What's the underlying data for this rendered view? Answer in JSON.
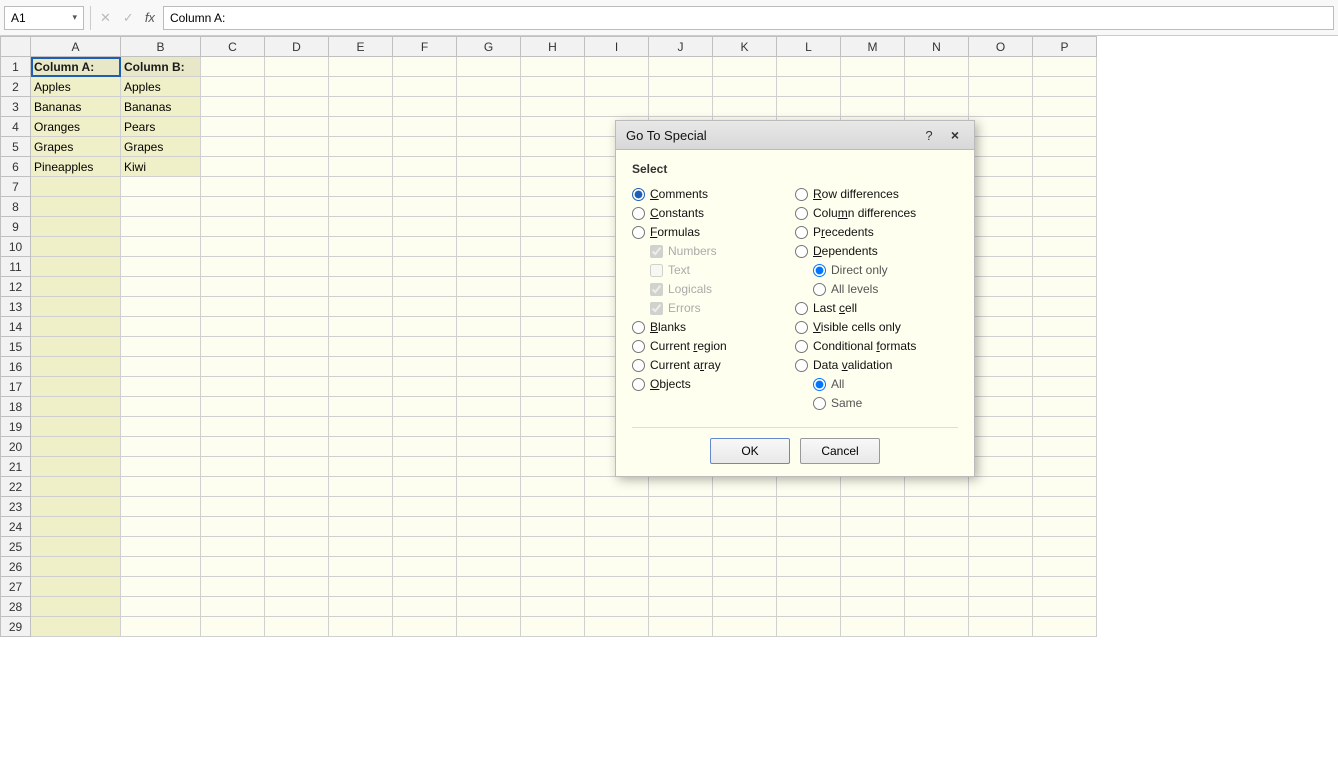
{
  "formula_bar": {
    "cell_ref": "A1",
    "formula_content": "Column A:",
    "undo_icon": "✕",
    "confirm_icon": "✓",
    "fx_label": "fx"
  },
  "spreadsheet": {
    "columns": [
      "A",
      "B",
      "C",
      "D",
      "E",
      "F",
      "G",
      "H",
      "I",
      "J",
      "K",
      "L",
      "M",
      "N",
      "O",
      "P"
    ],
    "rows": [
      {
        "row_num": 1,
        "col_a": "Column A:",
        "col_b": "Column B:",
        "is_header": true
      },
      {
        "row_num": 2,
        "col_a": "Apples",
        "col_b": "Apples"
      },
      {
        "row_num": 3,
        "col_a": "Bananas",
        "col_b": "Bananas"
      },
      {
        "row_num": 4,
        "col_a": "Oranges",
        "col_b": "Pears"
      },
      {
        "row_num": 5,
        "col_a": "Grapes",
        "col_b": "Grapes"
      },
      {
        "row_num": 6,
        "col_a": "Pineapples",
        "col_b": "Kiwi"
      },
      {
        "row_num": 7,
        "col_a": "",
        "col_b": ""
      },
      {
        "row_num": 8,
        "col_a": "",
        "col_b": ""
      },
      {
        "row_num": 9,
        "col_a": "",
        "col_b": ""
      },
      {
        "row_num": 10,
        "col_a": "",
        "col_b": ""
      },
      {
        "row_num": 11,
        "col_a": "",
        "col_b": ""
      },
      {
        "row_num": 12,
        "col_a": "",
        "col_b": ""
      },
      {
        "row_num": 13,
        "col_a": "",
        "col_b": ""
      },
      {
        "row_num": 14,
        "col_a": "",
        "col_b": ""
      },
      {
        "row_num": 15,
        "col_a": "",
        "col_b": ""
      },
      {
        "row_num": 16,
        "col_a": "",
        "col_b": ""
      },
      {
        "row_num": 17,
        "col_a": "",
        "col_b": ""
      },
      {
        "row_num": 18,
        "col_a": "",
        "col_b": ""
      },
      {
        "row_num": 19,
        "col_a": "",
        "col_b": ""
      },
      {
        "row_num": 20,
        "col_a": "",
        "col_b": ""
      },
      {
        "row_num": 21,
        "col_a": "",
        "col_b": ""
      },
      {
        "row_num": 22,
        "col_a": "",
        "col_b": ""
      },
      {
        "row_num": 23,
        "col_a": "",
        "col_b": ""
      },
      {
        "row_num": 24,
        "col_a": "",
        "col_b": ""
      },
      {
        "row_num": 25,
        "col_a": "",
        "col_b": ""
      },
      {
        "row_num": 26,
        "col_a": "",
        "col_b": ""
      },
      {
        "row_num": 27,
        "col_a": "",
        "col_b": ""
      },
      {
        "row_num": 28,
        "col_a": "",
        "col_b": ""
      },
      {
        "row_num": 29,
        "col_a": "",
        "col_b": ""
      }
    ]
  },
  "dialog": {
    "title": "Go To Special",
    "help_label": "?",
    "close_label": "×",
    "select_label": "Select",
    "left_options": [
      {
        "id": "opt_comments",
        "label": "Comments",
        "type": "radio",
        "checked": true,
        "underline_index": 0
      },
      {
        "id": "opt_constants",
        "label": "Constants",
        "type": "radio",
        "checked": false,
        "underline_index": 0
      },
      {
        "id": "opt_formulas",
        "label": "Formulas",
        "type": "radio",
        "checked": false,
        "underline_index": 0
      },
      {
        "id": "opt_numbers",
        "label": "Numbers",
        "type": "checkbox",
        "checked": true,
        "disabled": true
      },
      {
        "id": "opt_text",
        "label": "Text",
        "type": "checkbox",
        "checked": false,
        "disabled": true
      },
      {
        "id": "opt_logicals",
        "label": "Logicals",
        "type": "checkbox",
        "checked": true,
        "disabled": true
      },
      {
        "id": "opt_errors",
        "label": "Errors",
        "type": "checkbox",
        "checked": true,
        "disabled": true
      },
      {
        "id": "opt_blanks",
        "label": "Blanks",
        "type": "radio",
        "checked": false
      },
      {
        "id": "opt_current_region",
        "label": "Current region",
        "type": "radio",
        "checked": false
      },
      {
        "id": "opt_current_array",
        "label": "Current array",
        "type": "radio",
        "checked": false
      },
      {
        "id": "opt_objects",
        "label": "Objects",
        "type": "radio",
        "checked": false
      }
    ],
    "right_options": [
      {
        "id": "opt_row_diff",
        "label": "Row differences",
        "type": "radio",
        "checked": false
      },
      {
        "id": "opt_col_diff",
        "label": "Column differences",
        "type": "radio",
        "checked": false
      },
      {
        "id": "opt_precedents",
        "label": "Precedents",
        "type": "radio",
        "checked": false
      },
      {
        "id": "opt_dependents",
        "label": "Dependents",
        "type": "radio",
        "checked": false
      },
      {
        "id": "opt_direct_only",
        "label": "Direct only",
        "type": "sub_radio",
        "checked": true,
        "disabled": false
      },
      {
        "id": "opt_all_levels",
        "label": "All levels",
        "type": "sub_radio",
        "checked": false,
        "disabled": false
      },
      {
        "id": "opt_last_cell",
        "label": "Last cell",
        "type": "radio",
        "checked": false
      },
      {
        "id": "opt_visible_cells",
        "label": "Visible cells only",
        "type": "radio",
        "checked": false
      },
      {
        "id": "opt_cond_formats",
        "label": "Conditional formats",
        "type": "radio",
        "checked": false
      },
      {
        "id": "opt_data_valid",
        "label": "Data validation",
        "type": "radio",
        "checked": false
      },
      {
        "id": "opt_all_sub",
        "label": "All",
        "type": "sub_radio",
        "checked": true,
        "disabled": false
      },
      {
        "id": "opt_same_sub",
        "label": "Same",
        "type": "sub_radio",
        "checked": false,
        "disabled": false
      }
    ],
    "ok_label": "OK",
    "cancel_label": "Cancel"
  }
}
